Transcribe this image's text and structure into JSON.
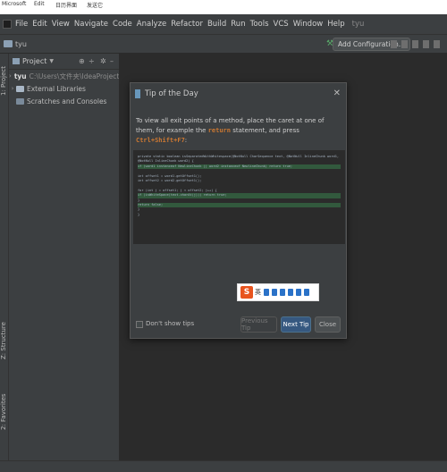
{
  "taskbar": {
    "items": [
      "Microsoft",
      "Edit",
      "日历界面",
      "发送它"
    ]
  },
  "menubar": {
    "items": [
      "File",
      "Edit",
      "View",
      "Navigate",
      "Code",
      "Analyze",
      "Refactor",
      "Build",
      "Run",
      "Tools",
      "VCS",
      "Window",
      "Help"
    ],
    "project_name": "tyu"
  },
  "toolbar": {
    "project_label": "tyu",
    "add_config_label": "Add Configuration..."
  },
  "side_tabs": {
    "project": "1: Project",
    "structure": "Z: Structure",
    "favorites": "2: Favorites"
  },
  "project_panel": {
    "title": "Project",
    "tree": [
      {
        "name": "tyu",
        "path": "C:\\Users\\文件夹\\IdeaProjects\\tyu"
      },
      {
        "name": "External Libraries",
        "path": ""
      },
      {
        "name": "Scratches and Consoles",
        "path": ""
      }
    ]
  },
  "tip_dialog": {
    "title": "Tip of the Day",
    "text_before": "To view all exit points of a method, place the caret at one of them, for example the",
    "keyword": "return",
    "text_middle": "statement, and press",
    "shortcut": "Ctrl+Shift+F7",
    "text_end": ":",
    "code_lines": [
      "private static boolean isSeparatedWithWhitespace(@NotNull CharSequence text, @NotNull InlineChunk word1, @NotNull InlineChunk word2) {",
      "  if (word1 instanceof NewlineChunk || word2 instanceof NewlineChunk) return true;",
      "",
      "  int offset1 = word1.getOffset1();",
      "  int offset2 = word2.getOffset1();",
      "",
      "  for (int j = offset1; j < offset2; j++) {",
      "    if (isWhiteSpace(text.charAt(j))) return true;",
      "  }",
      "  return false;",
      "  }",
      "}"
    ],
    "dont_show_label": "Don't show tips",
    "prev_label": "Previous Tip",
    "next_label": "Next Tip",
    "close_label": "Close"
  },
  "ime_toolbar": {
    "logo": "S",
    "mode": "英"
  }
}
